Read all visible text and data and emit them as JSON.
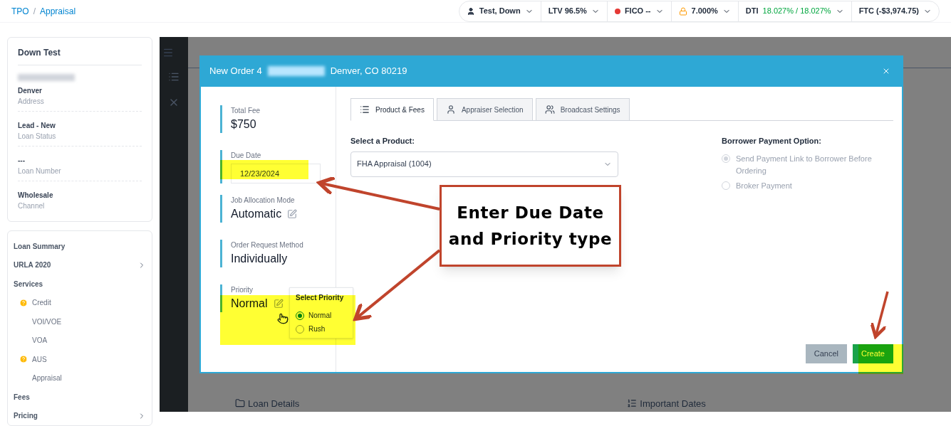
{
  "breadcrumb": {
    "items": [
      "TPO",
      "Appraisal"
    ],
    "separator": "/"
  },
  "status_chips": [
    {
      "kind": "user",
      "label": "Test, Down"
    },
    {
      "kind": "plain",
      "label": "LTV 96.5%"
    },
    {
      "kind": "dot",
      "label": "FICO --",
      "color": "#e53935"
    },
    {
      "kind": "lock",
      "label": "7.000%"
    },
    {
      "kind": "split",
      "label": "DTI",
      "value": "18.027% / 18.027%"
    },
    {
      "kind": "plain",
      "label": "FTC (-$3,974.75)"
    }
  ],
  "borrower_card": {
    "name": "Down Test",
    "fields": [
      {
        "value": "Denver",
        "label": "Address"
      },
      {
        "value": "Lead - New",
        "label": "Loan Status"
      },
      {
        "value": "---",
        "label": "Loan Number"
      },
      {
        "value": "Wholesale",
        "label": "Channel"
      }
    ]
  },
  "nav": [
    {
      "label": "Loan Summary",
      "kind": "section",
      "chevron": false
    },
    {
      "label": "URLA 2020",
      "kind": "section",
      "chevron": true
    },
    {
      "label": "Services",
      "kind": "section",
      "chevron": false
    },
    {
      "label": "Credit",
      "kind": "sub",
      "warning": true
    },
    {
      "label": "VOI/VOE",
      "kind": "sub",
      "warning": false
    },
    {
      "label": "VOA",
      "kind": "sub",
      "warning": false
    },
    {
      "label": "AUS",
      "kind": "sub",
      "warning": true
    },
    {
      "label": "Appraisal",
      "kind": "sub",
      "warning": false
    },
    {
      "label": "Fees",
      "kind": "section",
      "chevron": false
    },
    {
      "label": "Pricing",
      "kind": "section",
      "chevron": true
    }
  ],
  "background_sections": [
    "Loan Details",
    "Important Dates"
  ],
  "modal": {
    "title_prefix": "New Order 4",
    "title_suffix": "Denver, CO 80219",
    "summary": [
      {
        "kind": "text",
        "label": "Total Fee",
        "value": "$750"
      },
      {
        "kind": "date",
        "label": "Due Date",
        "value": "12/23/2024"
      },
      {
        "kind": "editable",
        "label": "Job Allocation Mode",
        "value": "Automatic"
      },
      {
        "kind": "text",
        "label": "Order Request Method",
        "value": "Individually"
      },
      {
        "kind": "editable",
        "label": "Priority",
        "value": "Normal"
      }
    ],
    "priority_popup": {
      "title": "Select Priority",
      "options": [
        {
          "label": "Normal",
          "selected": true
        },
        {
          "label": "Rush",
          "selected": false
        }
      ]
    },
    "tabs": [
      {
        "label": "Product & Fees",
        "selected": true
      },
      {
        "label": "Appraiser Selection",
        "selected": false
      },
      {
        "label": "Broadcast Settings",
        "selected": false
      }
    ],
    "product": {
      "label": "Select a Product:",
      "value": "FHA Appraisal (1004)"
    },
    "payment": {
      "label": "Borrower Payment Option:",
      "options": [
        {
          "label": "Send Payment Link to Borrower Before Ordering",
          "selected": true,
          "disabled": true
        },
        {
          "label": "Broker Payment",
          "selected": false,
          "disabled": true
        }
      ]
    },
    "buttons": [
      {
        "label": "Cancel",
        "kind": "secondary"
      },
      {
        "label": "Create",
        "kind": "primary"
      }
    ]
  },
  "callout": {
    "lines": [
      "Enter Due Date",
      "and Priority type"
    ]
  }
}
